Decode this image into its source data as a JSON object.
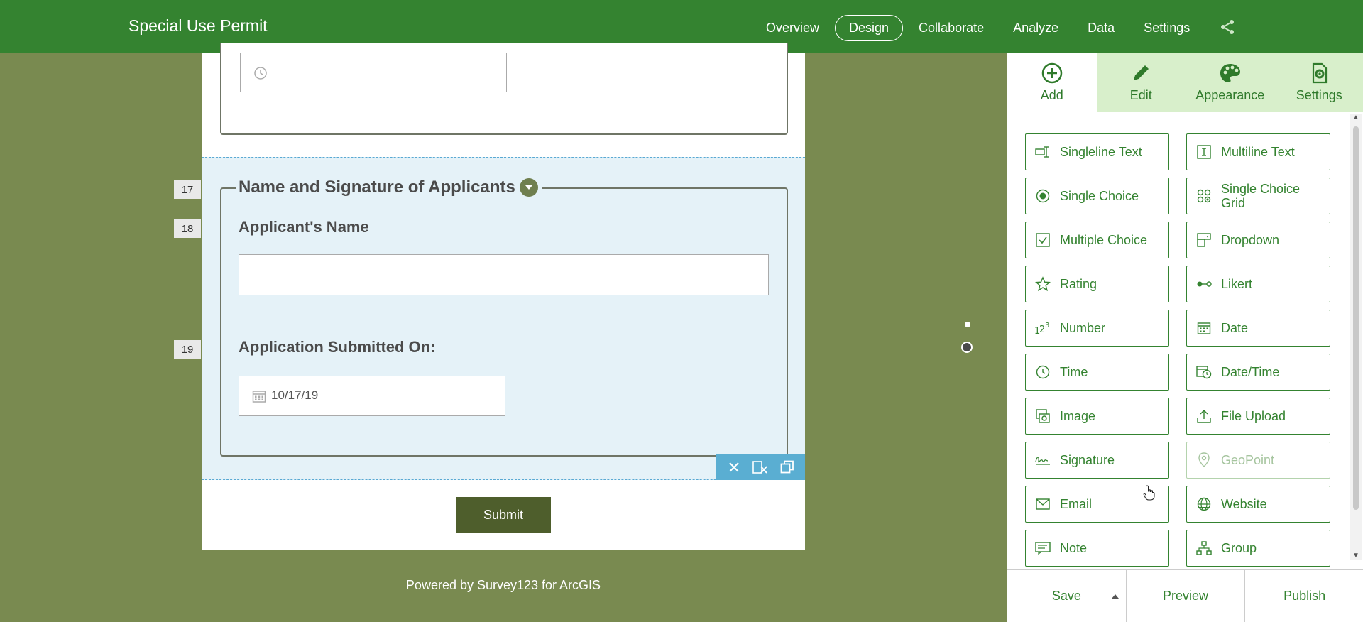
{
  "header": {
    "app_title": "Special Use Permit",
    "nav": [
      "Overview",
      "Design",
      "Collaborate",
      "Analyze",
      "Data",
      "Settings"
    ],
    "active_nav": "Design",
    "share_icon": "share-icon"
  },
  "form": {
    "group_title": "Name and Signature of Applicants",
    "question_numbers": [
      "17",
      "18",
      "19"
    ],
    "applicant_name_label": "Applicant's Name",
    "applicant_name_value": "",
    "submitted_on_label": "Application Submitted On:",
    "submitted_on_value": "10/17/19",
    "submit_label": "Submit",
    "powered_by": "Powered by Survey123 for ArcGIS"
  },
  "panel": {
    "tabs": [
      {
        "label": "Add",
        "icon": "plus-circle-icon"
      },
      {
        "label": "Edit",
        "icon": "pencil-icon"
      },
      {
        "label": "Appearance",
        "icon": "palette-icon"
      },
      {
        "label": "Settings",
        "icon": "gear-doc-icon"
      }
    ],
    "active_tab": "Add",
    "widgets": [
      {
        "label": "Singleline Text",
        "icon": "singleline-text-icon"
      },
      {
        "label": "Multiline Text",
        "icon": "multiline-text-icon"
      },
      {
        "label": "Single Choice",
        "icon": "radio-icon"
      },
      {
        "label": "Single Choice Grid",
        "icon": "choice-grid-icon"
      },
      {
        "label": "Multiple Choice",
        "icon": "checkbox-icon"
      },
      {
        "label": "Dropdown",
        "icon": "dropdown-icon"
      },
      {
        "label": "Rating",
        "icon": "star-icon"
      },
      {
        "label": "Likert",
        "icon": "likert-icon"
      },
      {
        "label": "Number",
        "icon": "number-icon"
      },
      {
        "label": "Date",
        "icon": "calendar-icon"
      },
      {
        "label": "Time",
        "icon": "clock-icon"
      },
      {
        "label": "Date/Time",
        "icon": "datetime-icon"
      },
      {
        "label": "Image",
        "icon": "image-icon"
      },
      {
        "label": "File Upload",
        "icon": "upload-icon"
      },
      {
        "label": "Signature",
        "icon": "signature-icon"
      },
      {
        "label": "GeoPoint",
        "icon": "geopoint-icon",
        "disabled": true
      },
      {
        "label": "Email",
        "icon": "email-icon"
      },
      {
        "label": "Website",
        "icon": "globe-icon"
      },
      {
        "label": "Note",
        "icon": "note-icon"
      },
      {
        "label": "Group",
        "icon": "group-icon"
      }
    ],
    "footer": {
      "save": "Save",
      "preview": "Preview",
      "publish": "Publish"
    }
  },
  "colors": {
    "header_green": "#348330",
    "canvas_bg": "#798a50",
    "selected_bg": "#e5f2f8",
    "submit_bg": "#4e5e2c",
    "toolbar_blue": "#5aaed2"
  }
}
